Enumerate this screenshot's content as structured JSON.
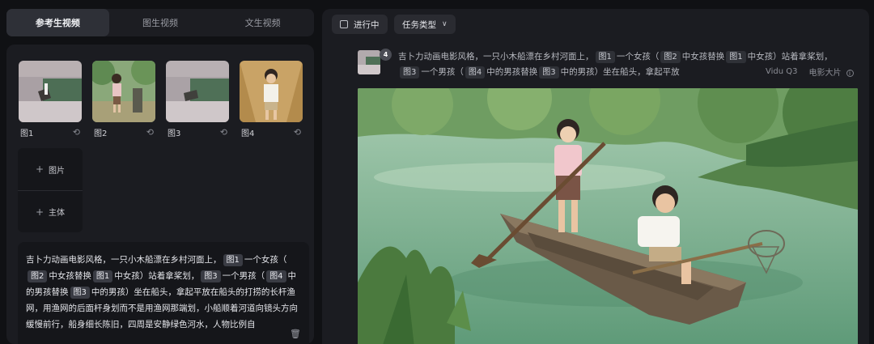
{
  "left_tabs": [
    "参考生视频",
    "图生视频",
    "文生视频"
  ],
  "references": [
    {
      "label": "图1"
    },
    {
      "label": "图2"
    },
    {
      "label": "图3"
    },
    {
      "label": "图4"
    }
  ],
  "add_buttons": {
    "image": "图片",
    "subject": "主体"
  },
  "prompt": {
    "t1": "吉卜力动画电影风格，一只小木船漂在乡村河面上，",
    "c1": "图1",
    "t2": "一个女孩（",
    "c2": "图2",
    "t3": "中女孩替换",
    "c3": "图1",
    "t4": "中女孩）站着拿桨划，",
    "c4": "图3",
    "t5": "一个男孩（",
    "c5": "图4",
    "t6": "中的男孩替换",
    "c6": "图3",
    "t7": "中的男孩）坐在船头，拿起平放在船头的打捞的长杆渔网，用渔网的后面杆身划而不是用渔网那端划，小船顺着河道向镜头方向缓慢前行，船身细长陈旧，四周是安静绿色河水，人物比例自"
  },
  "filters": {
    "in_progress": "进行中",
    "task_type": "任务类型"
  },
  "task": {
    "badge": "4",
    "t1": "吉卜力动画电影风格，一只小木船漂在乡村河面上，",
    "c1": "图1",
    "t2": "一个女孩（",
    "c2": "图2",
    "t3": "中女孩替换",
    "c3": "图1",
    "t4": "中女孩）站着拿桨划，",
    "c4": "图3",
    "t5": "一个男孩（",
    "c5": "图4",
    "t6": "中的男孩替换",
    "c6": "图3",
    "t7": "中的男孩）坐在船头，拿起平放",
    "model": "Vidu Q3",
    "style": "电影大片"
  },
  "colors": {
    "bg": "#101114",
    "panel": "#1b1c21",
    "chip": "#3a3c44",
    "water": "#7fb08f"
  }
}
